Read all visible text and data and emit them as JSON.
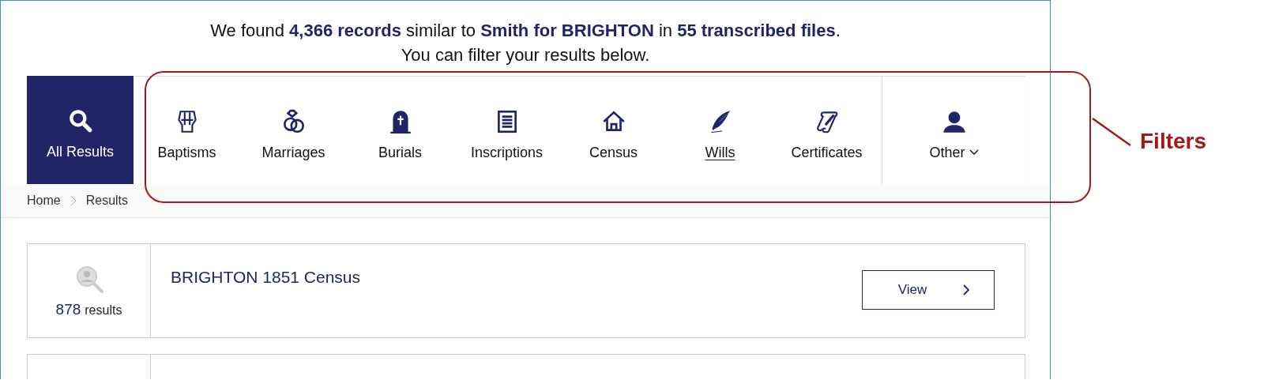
{
  "summary": {
    "line_1": "We found **4,366 records** similar to **Smith for BRIGHTON** in **55 transcribed files**.",
    "line_2": "You can filter your results below."
  },
  "tabs": [
    {
      "label": "All Results",
      "selected": true,
      "hovered": false,
      "kind": "plain"
    },
    {
      "label": "Baptisms",
      "selected": false,
      "hovered": false,
      "kind": "plain"
    },
    {
      "label": "Marriages",
      "selected": false,
      "hovered": false,
      "kind": "plain"
    },
    {
      "label": "Burials",
      "selected": false,
      "hovered": false,
      "kind": "plain"
    },
    {
      "label": "Inscriptions",
      "selected": false,
      "hovered": false,
      "kind": "plain"
    },
    {
      "label": "Census",
      "selected": false,
      "hovered": false,
      "kind": "plain"
    },
    {
      "label": "Wills",
      "selected": false,
      "hovered": true,
      "kind": "plain"
    },
    {
      "label": "Certificates",
      "selected": false,
      "hovered": false,
      "kind": "plain"
    },
    {
      "label": "Other",
      "selected": false,
      "hovered": false,
      "kind": "dropdown"
    }
  ],
  "breadcrumb": [
    "Home",
    "Results"
  ],
  "results": [
    {
      "count": "878",
      "count_label": "results",
      "title": "BRIGHTON 1851 Census",
      "button": "View"
    }
  ],
  "annotation": {
    "label": "Filters"
  }
}
